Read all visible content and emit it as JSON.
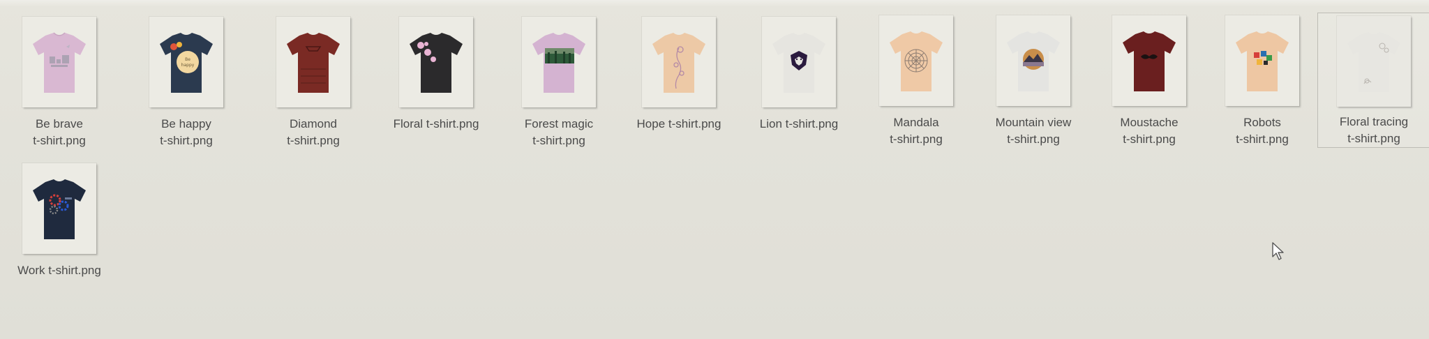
{
  "folder": {
    "files": [
      {
        "line1": "Be brave",
        "line2": "t-shirt.png",
        "shirt_color": "#d9b8d2",
        "design": "text-art"
      },
      {
        "line1": "Be happy",
        "line2": "t-shirt.png",
        "shirt_color": "#2b3a4f",
        "design": "circle-text"
      },
      {
        "line1": "Diamond",
        "line2": "t-shirt.png",
        "shirt_color": "#7a2a24",
        "design": "diamond-pattern"
      },
      {
        "line1": "Floral t-shirt.png",
        "line2": "",
        "shirt_color": "#2b2a2c",
        "design": "flowers"
      },
      {
        "line1": "Forest magic",
        "line2": "t-shirt.png",
        "shirt_color": "#d4b3d1",
        "design": "forest-photo"
      },
      {
        "line1": "Hope t-shirt.png",
        "line2": "",
        "shirt_color": "#edc9a6",
        "design": "floral-lines"
      },
      {
        "line1": "Lion t-shirt.png",
        "line2": "",
        "shirt_color": "#e6e5e0",
        "design": "lion-head"
      },
      {
        "line1": "Mandala",
        "line2": "t-shirt.png",
        "shirt_color": "#efc9a6",
        "design": "mandala"
      },
      {
        "line1": "Mountain view",
        "line2": "t-shirt.png",
        "shirt_color": "#e4e4e1",
        "design": "mountain-circle"
      },
      {
        "line1": "Moustache",
        "line2": "t-shirt.png",
        "shirt_color": "#6a1f1f",
        "design": "moustache"
      },
      {
        "line1": "Robots",
        "line2": "t-shirt.png",
        "shirt_color": "#eec7a3",
        "design": "robots"
      },
      {
        "line1": "Floral tracing",
        "line2": "t-shirt.png",
        "shirt_color": "#e7e6e1",
        "design": "faint-floral"
      },
      {
        "line1": "Work t-shirt.png",
        "line2": "",
        "shirt_color": "#1f2a3e",
        "design": "gears"
      }
    ]
  },
  "colors": {
    "background": "#e3e2da",
    "label_text": "#4a4a4a",
    "selection_border": "#bdbcb5"
  },
  "cursor": {
    "icon": "arrow-pointer-icon"
  }
}
